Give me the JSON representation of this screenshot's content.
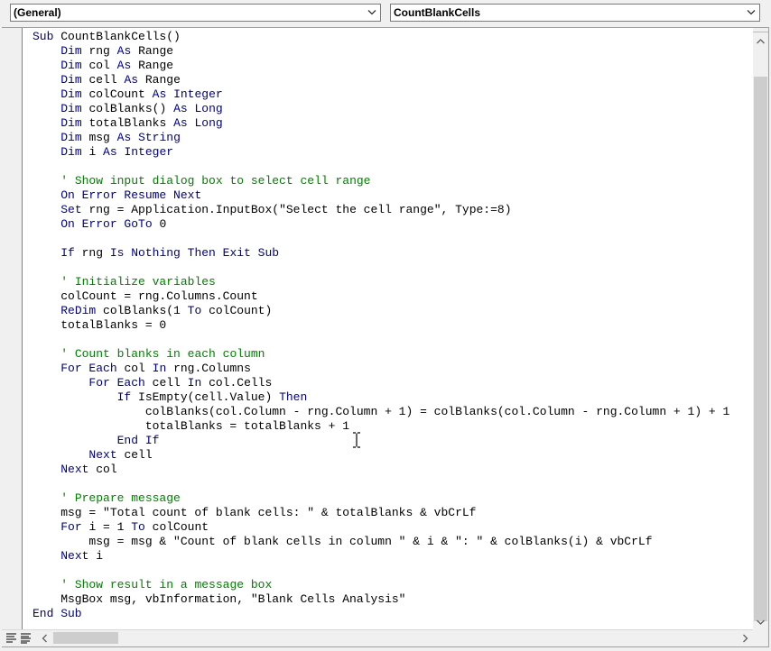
{
  "toolbar": {
    "object_combo": "(General)",
    "procedure_combo": "CountBlankCells"
  },
  "code_lines": [
    [
      {
        "t": "Sub ",
        "c": "kw"
      },
      {
        "t": "CountBlankCells()"
      }
    ],
    [
      {
        "t": "    "
      },
      {
        "t": "Dim ",
        "c": "kw"
      },
      {
        "t": "rng "
      },
      {
        "t": "As ",
        "c": "kw"
      },
      {
        "t": "Range"
      }
    ],
    [
      {
        "t": "    "
      },
      {
        "t": "Dim ",
        "c": "kw"
      },
      {
        "t": "col "
      },
      {
        "t": "As ",
        "c": "kw"
      },
      {
        "t": "Range"
      }
    ],
    [
      {
        "t": "    "
      },
      {
        "t": "Dim ",
        "c": "kw"
      },
      {
        "t": "cell "
      },
      {
        "t": "As ",
        "c": "kw"
      },
      {
        "t": "Range"
      }
    ],
    [
      {
        "t": "    "
      },
      {
        "t": "Dim ",
        "c": "kw"
      },
      {
        "t": "colCount "
      },
      {
        "t": "As ",
        "c": "kw"
      },
      {
        "t": "Integer",
        "c": "kw"
      }
    ],
    [
      {
        "t": "    "
      },
      {
        "t": "Dim ",
        "c": "kw"
      },
      {
        "t": "colBlanks() "
      },
      {
        "t": "As ",
        "c": "kw"
      },
      {
        "t": "Long",
        "c": "kw"
      }
    ],
    [
      {
        "t": "    "
      },
      {
        "t": "Dim ",
        "c": "kw"
      },
      {
        "t": "totalBlanks "
      },
      {
        "t": "As ",
        "c": "kw"
      },
      {
        "t": "Long",
        "c": "kw"
      }
    ],
    [
      {
        "t": "    "
      },
      {
        "t": "Dim ",
        "c": "kw"
      },
      {
        "t": "msg "
      },
      {
        "t": "As ",
        "c": "kw"
      },
      {
        "t": "String",
        "c": "kw"
      }
    ],
    [
      {
        "t": "    "
      },
      {
        "t": "Dim ",
        "c": "kw"
      },
      {
        "t": "i "
      },
      {
        "t": "As ",
        "c": "kw"
      },
      {
        "t": "Integer",
        "c": "kw"
      }
    ],
    [],
    [
      {
        "t": "    "
      },
      {
        "t": "' Show input dialog box to select cell range",
        "c": "cm"
      }
    ],
    [
      {
        "t": "    "
      },
      {
        "t": "On Error Resume Next",
        "c": "kw"
      }
    ],
    [
      {
        "t": "    "
      },
      {
        "t": "Set ",
        "c": "kw"
      },
      {
        "t": "rng = Application.InputBox(\"Select the cell range\", Type:=8)"
      }
    ],
    [
      {
        "t": "    "
      },
      {
        "t": "On Error GoTo ",
        "c": "kw"
      },
      {
        "t": "0"
      }
    ],
    [],
    [
      {
        "t": "    "
      },
      {
        "t": "If ",
        "c": "kw"
      },
      {
        "t": "rng "
      },
      {
        "t": "Is Nothing Then Exit Sub",
        "c": "kw"
      }
    ],
    [],
    [
      {
        "t": "    "
      },
      {
        "t": "' Initialize variables",
        "c": "cm"
      }
    ],
    [
      {
        "t": "    colCount = rng.Columns.Count"
      }
    ],
    [
      {
        "t": "    "
      },
      {
        "t": "ReDim ",
        "c": "kw"
      },
      {
        "t": "colBlanks(1 "
      },
      {
        "t": "To ",
        "c": "kw"
      },
      {
        "t": "colCount)"
      }
    ],
    [
      {
        "t": "    totalBlanks = 0"
      }
    ],
    [],
    [
      {
        "t": "    "
      },
      {
        "t": "' Count blanks in each column",
        "c": "cm"
      }
    ],
    [
      {
        "t": "    "
      },
      {
        "t": "For Each ",
        "c": "kw"
      },
      {
        "t": "col "
      },
      {
        "t": "In ",
        "c": "kw"
      },
      {
        "t": "rng.Columns"
      }
    ],
    [
      {
        "t": "        "
      },
      {
        "t": "For Each ",
        "c": "kw"
      },
      {
        "t": "cell "
      },
      {
        "t": "In ",
        "c": "kw"
      },
      {
        "t": "col.Cells"
      }
    ],
    [
      {
        "t": "            "
      },
      {
        "t": "If ",
        "c": "kw"
      },
      {
        "t": "IsEmpty(cell.Value) "
      },
      {
        "t": "Then",
        "c": "kw"
      }
    ],
    [
      {
        "t": "                colBlanks(col.Column - rng.Column + 1) = colBlanks(col.Column - rng.Column + 1) + 1"
      }
    ],
    [
      {
        "t": "                totalBlanks = totalBlanks + 1"
      }
    ],
    [
      {
        "t": "            "
      },
      {
        "t": "End If",
        "c": "kw"
      }
    ],
    [
      {
        "t": "        "
      },
      {
        "t": "Next ",
        "c": "kw"
      },
      {
        "t": "cell"
      }
    ],
    [
      {
        "t": "    "
      },
      {
        "t": "Next ",
        "c": "kw"
      },
      {
        "t": "col"
      }
    ],
    [],
    [
      {
        "t": "    "
      },
      {
        "t": "' Prepare message",
        "c": "cm"
      }
    ],
    [
      {
        "t": "    msg = \"Total count of blank cells: \" & totalBlanks & vbCrLf"
      }
    ],
    [
      {
        "t": "    "
      },
      {
        "t": "For ",
        "c": "kw"
      },
      {
        "t": "i = 1 "
      },
      {
        "t": "To ",
        "c": "kw"
      },
      {
        "t": "colCount"
      }
    ],
    [
      {
        "t": "        msg = msg & \"Count of blank cells in column \" & i & \": \" & colBlanks(i) & vbCrLf"
      }
    ],
    [
      {
        "t": "    "
      },
      {
        "t": "Next ",
        "c": "kw"
      },
      {
        "t": "i"
      }
    ],
    [],
    [
      {
        "t": "    "
      },
      {
        "t": "' Show result in a message box",
        "c": "cm"
      }
    ],
    [
      {
        "t": "    MsgBox msg, vbInformation, \"Blank Cells Analysis\""
      }
    ],
    [
      {
        "t": "End Sub",
        "c": "kw"
      }
    ]
  ],
  "colors": {
    "keyword": "#00007f",
    "comment": "#007f00",
    "text": "#000000"
  },
  "icons": {
    "combo_dropdown": "chevron-down-icon",
    "procedure_view": "procedure-view-icon",
    "full_module_view": "full-module-view-icon",
    "scroll_up": "arrow-up-icon",
    "scroll_down": "arrow-down-icon",
    "scroll_left": "arrow-left-icon",
    "scroll_right": "arrow-right-icon",
    "text_cursor": "i-beam-cursor-icon"
  }
}
